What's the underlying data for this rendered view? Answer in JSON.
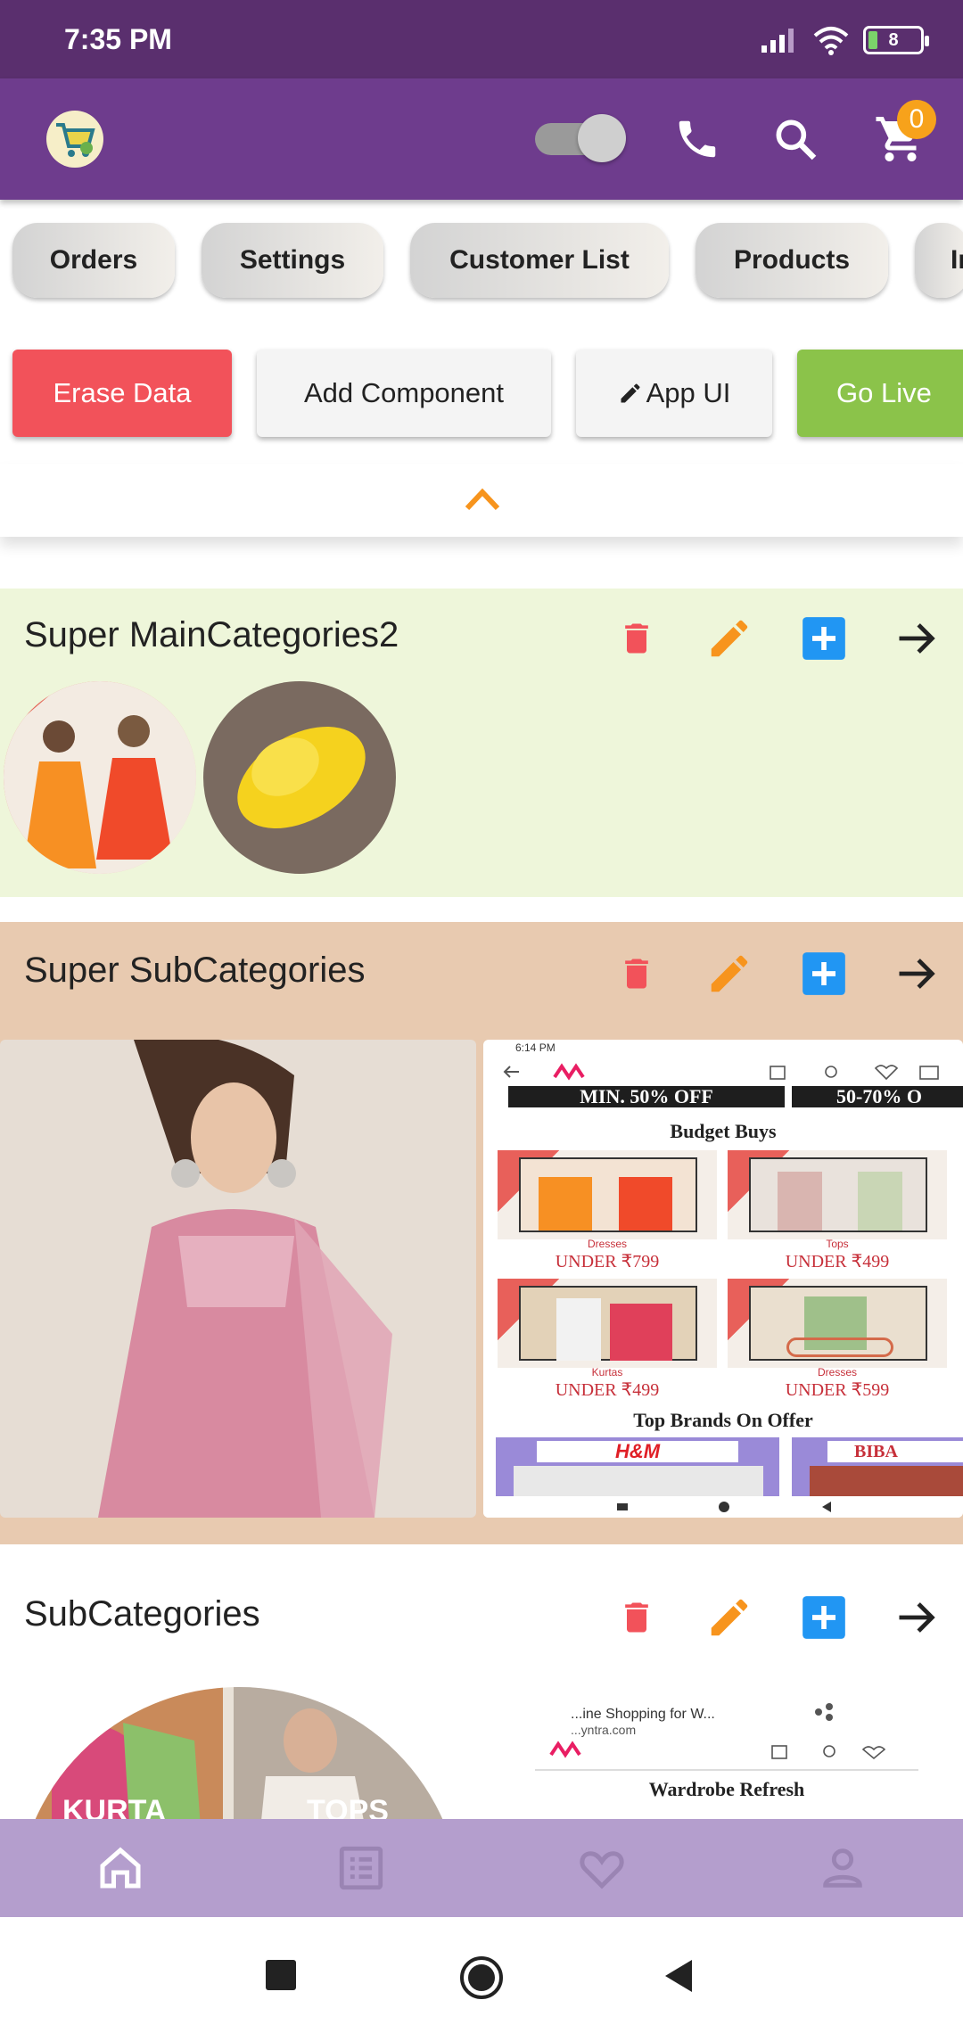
{
  "status": {
    "time": "7:35 PM",
    "battery": "8"
  },
  "app_bar": {
    "cart_count": "0"
  },
  "chips": [
    "Orders",
    "Settings",
    "Customer List",
    "Products",
    "In"
  ],
  "actions": {
    "erase": "Erase Data",
    "add_component": "Add Component",
    "app_ui": "App UI",
    "go_live": "Go Live"
  },
  "sections": {
    "main_categories": {
      "title": "Super MainCategories2"
    },
    "sub_categories_super": {
      "title": "Super SubCategories",
      "screenshot": {
        "time": "6:14 PM",
        "banner_left": "MIN. 50% OFF",
        "banner_right": "50-70% O",
        "heading": "Budget Buys",
        "tiles": [
          {
            "cat": "Dresses",
            "price": "UNDER ₹799"
          },
          {
            "cat": "Tops",
            "price": "UNDER ₹499"
          },
          {
            "cat": "Kurtas",
            "price": "UNDER ₹499"
          },
          {
            "cat": "Dresses",
            "price": "UNDER ₹599"
          }
        ],
        "brands_heading": "Top Brands On Offer",
        "brand1": "H&M",
        "brand2": "BIBA"
      }
    },
    "sub_categories": {
      "title": "SubCategories",
      "circle1_label": "KURTA",
      "circle2_label": "TOPS",
      "screenshot": {
        "tab_title": "...ine Shopping for W...",
        "tab_url": "...yntra.com",
        "heading": "Wardrobe Refresh"
      }
    }
  },
  "colors": {
    "status_bar": "#5a2f6e",
    "app_bar": "#6e3c8d",
    "erase": "#f2525a",
    "go_live": "#8bc34a",
    "delete": "#f2525a",
    "edit": "#f7941d",
    "add": "#2196f3",
    "section1_bg": "#eef6da",
    "section2_bg": "#e8cab0",
    "bottom_nav": "#b49ecd"
  }
}
